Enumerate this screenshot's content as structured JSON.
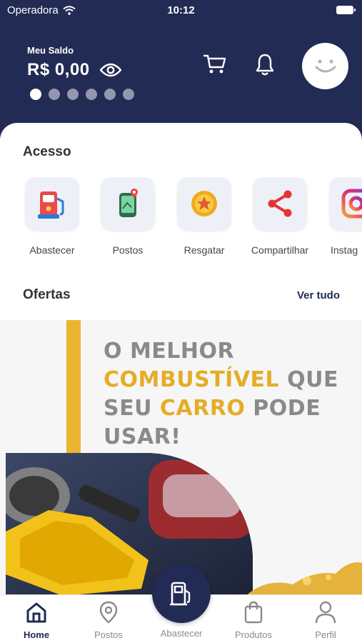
{
  "status_bar": {
    "carrier": "Operadora",
    "time": "10:12"
  },
  "balance": {
    "label": "Meu Saldo",
    "value": "R$ 0,00"
  },
  "carousel": {
    "count": 6,
    "active_index": 0
  },
  "access": {
    "title": "Acesso",
    "items": [
      {
        "label": "Abastecer",
        "icon": "fuel-pump-icon"
      },
      {
        "label": "Postos",
        "icon": "map-pin-icon"
      },
      {
        "label": "Resgatar",
        "icon": "coin-star-icon"
      },
      {
        "label": "Compartilhar",
        "icon": "share-icon"
      },
      {
        "label": "Instag",
        "icon": "instagram-icon"
      }
    ]
  },
  "offers": {
    "title": "Ofertas",
    "see_all": "Ver tudo",
    "banner": {
      "line1": "O MELHOR",
      "line2_hl": "COMBUSTÍVEL",
      "line2_rest": " QUE",
      "line3_a": "SEU ",
      "line3_hl": "CARRO",
      "line3_rest": " PODE",
      "line4": "USAR!"
    }
  },
  "bottom_nav": {
    "items": [
      {
        "label": "Home",
        "icon": "home-icon",
        "active": true
      },
      {
        "label": "Postos",
        "icon": "location-pin-icon",
        "active": false
      },
      {
        "label": "Abastecer",
        "icon": "fuel-pump-icon",
        "active": false
      },
      {
        "label": "Produtos",
        "icon": "shopping-bag-icon",
        "active": false
      },
      {
        "label": "Perfil",
        "icon": "user-icon",
        "active": false
      }
    ]
  },
  "colors": {
    "primary": "#222b54",
    "accent": "#eab632",
    "background": "#ffffff"
  }
}
